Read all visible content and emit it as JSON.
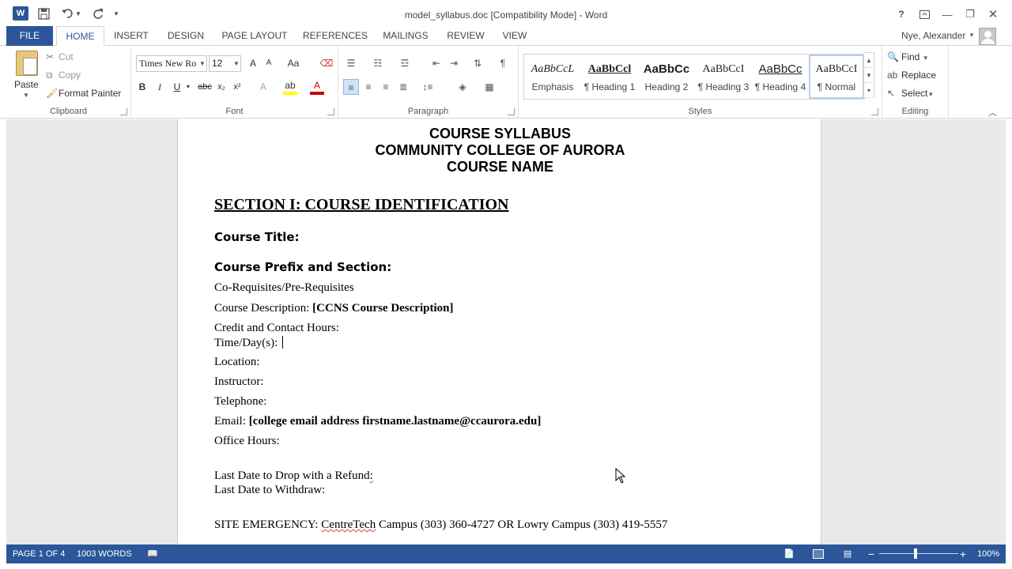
{
  "window": {
    "title": "model_syllabus.doc [Compatibility Mode] - Word",
    "app_icon": "W",
    "controls": {
      "help": "?",
      "minimize": "—",
      "restore": "❐",
      "close": "✕"
    }
  },
  "qat": {
    "save_icon": "save-icon",
    "undo_icon": "undo-icon",
    "redo_icon": "redo-icon"
  },
  "tabs": [
    "FILE",
    "HOME",
    "INSERT",
    "DESIGN",
    "PAGE LAYOUT",
    "REFERENCES",
    "MAILINGS",
    "REVIEW",
    "VIEW"
  ],
  "active_tab": "HOME",
  "user": {
    "name": "Nye, Alexander"
  },
  "ribbon": {
    "clipboard": {
      "label": "Clipboard",
      "paste": "Paste",
      "cut": "Cut",
      "copy": "Copy",
      "format_painter": "Format Painter"
    },
    "font": {
      "label": "Font",
      "font_name": "Times New Ro",
      "font_size": "12",
      "grow": "A",
      "shrink": "A",
      "change_case": "Aa",
      "bold": "B",
      "italic": "I",
      "underline": "U",
      "strike": "abc",
      "subscript": "x₂",
      "superscript": "x²",
      "text_effects": "A",
      "highlight": "ab",
      "font_color": "A"
    },
    "paragraph": {
      "label": "Paragraph"
    },
    "styles": {
      "label": "Styles",
      "items": [
        {
          "sample": "AaBbCcL",
          "name": "Emphasis"
        },
        {
          "sample": "AaBbCcl",
          "name": "¶ Heading 1"
        },
        {
          "sample": "AaBbCc",
          "name": "Heading 2"
        },
        {
          "sample": "AaBbCcI",
          "name": "¶ Heading 3"
        },
        {
          "sample": "AaBbCc",
          "name": "¶ Heading 4"
        },
        {
          "sample": "AaBbCcI",
          "name": "¶ Normal"
        }
      ],
      "selected": "¶ Normal"
    },
    "editing": {
      "label": "Editing",
      "find": "Find",
      "replace": "Replace",
      "select": "Select"
    }
  },
  "document": {
    "header_lines": [
      "COURSE SYLLABUS",
      "COMMUNITY COLLEGE OF AURORA",
      "COURSE NAME"
    ],
    "section_heading": "SECTION I: COURSE IDENTIFICATION",
    "course_title": "Course Title:",
    "course_prefix": "Course Prefix and Section:",
    "coreq": "Co-Requisites/Pre-Requisites",
    "desc_label": "Course Description: ",
    "desc_value": "[CCNS Course Description]",
    "credit": "Credit and Contact Hours:",
    "timeday": "Time/Day(s):",
    "location": "Location:",
    "instructor": "Instructor:",
    "telephone": "Telephone:",
    "email_label": "Email: ",
    "email_value": "[college email address firstname.lastname@ccaurora.edu]",
    "office": "Office Hours:",
    "drop": "Last Date to Drop with a Refund",
    "drop_mark": ":",
    "withdraw": "Last Date to Withdraw:",
    "emergency_prefix": "SITE EMERGENCY: ",
    "emergency_underlined": "CentreTech",
    "emergency_rest": " Campus (303) 360-4727 OR Lowry Campus (303) 419-5557"
  },
  "status": {
    "page": "PAGE 1 OF 4",
    "words": "1003 WORDS",
    "zoom": "100%",
    "zoom_level_percent": 100,
    "view_mode": "print-layout"
  }
}
